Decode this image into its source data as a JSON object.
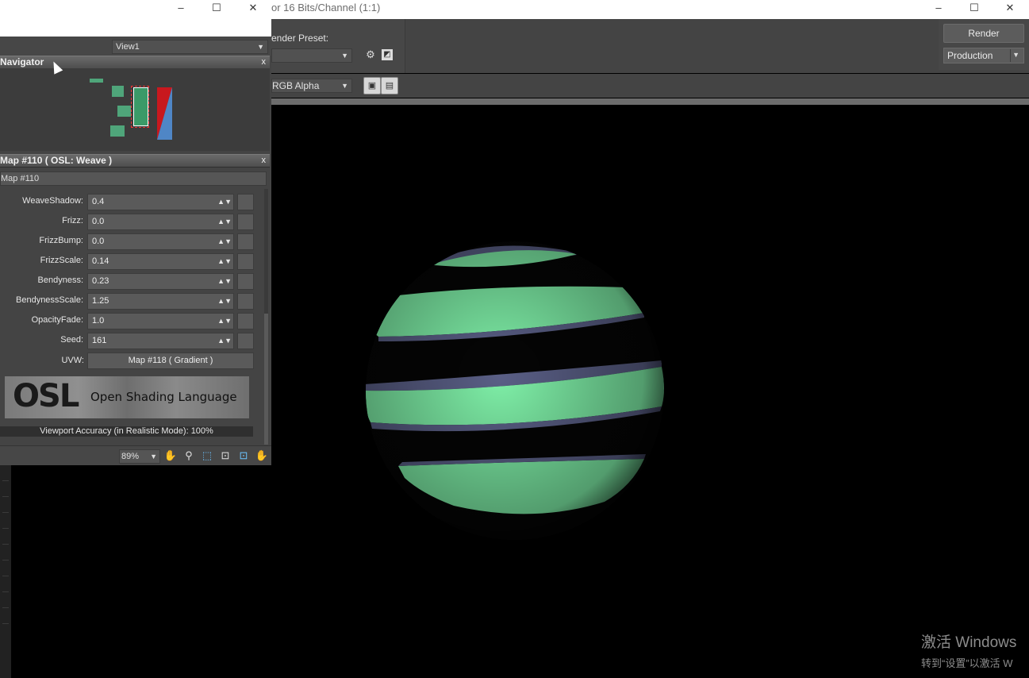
{
  "render_window": {
    "title": "or 16 Bits/Channel (1:1)",
    "render_preset_label": "ender Preset:",
    "render_preset_value": "",
    "render_button": "Render",
    "production_select": "Production",
    "channel_select": "RGB Alpha",
    "window_controls": [
      "–",
      "☐",
      "✕"
    ]
  },
  "material_editor": {
    "window_controls": [
      "–",
      "☐",
      "✕"
    ],
    "view_select": "View1",
    "navigator_title": "Navigator",
    "map_panel_title": "Map #110  ( OSL: Weave )",
    "map_name": "Map #110",
    "params": [
      {
        "label": "WeaveShadow:",
        "value": "0.4"
      },
      {
        "label": "Frizz:",
        "value": "0.0"
      },
      {
        "label": "FrizzBump:",
        "value": "0.0"
      },
      {
        "label": "FrizzScale:",
        "value": "0.14"
      },
      {
        "label": "Bendyness:",
        "value": "0.23"
      },
      {
        "label": "BendynessScale:",
        "value": "1.25"
      },
      {
        "label": "OpacityFade:",
        "value": "1.0"
      },
      {
        "label": "Seed:",
        "value": "161"
      }
    ],
    "uvw_label": "UVW:",
    "uvw_button": "Map #118  ( Gradient )",
    "osl_logo": "OSL",
    "osl_banner_text": "Open Shading Language",
    "viewport_accuracy": "Viewport Accuracy (in Realistic Mode): 100%",
    "zoom": "89%"
  },
  "windows_activation": {
    "line1": "激活 Windows",
    "line2": "转到“设置”以激活 W"
  },
  "colors": {
    "stripe_green": "#7ff0a8",
    "stripe_edge": "#5a5f86",
    "panel_bg": "#444444"
  }
}
